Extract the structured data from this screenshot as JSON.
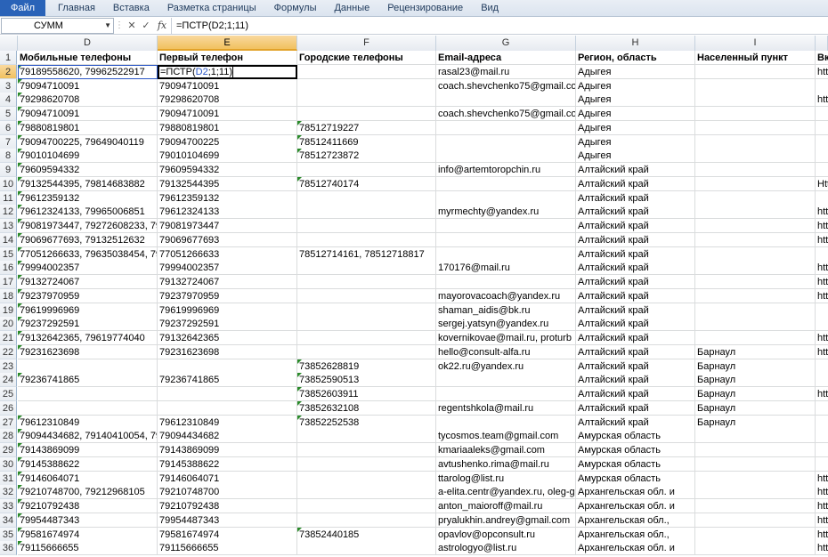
{
  "ribbon": {
    "tabs": [
      "Файл",
      "Главная",
      "Вставка",
      "Разметка страницы",
      "Формулы",
      "Данные",
      "Рецензирование",
      "Вид"
    ]
  },
  "formula_bar": {
    "name_box": "СУММ",
    "cancel_icon": "✕",
    "enter_icon": "✓",
    "fx_label": "fx",
    "formula": "=ПСТР(D2;1;11)"
  },
  "columns": [
    "D",
    "E",
    "F",
    "G",
    "H",
    "I"
  ],
  "active_cell": {
    "prefix": "=ПСТР(",
    "ref": "D2",
    "suffix": ";1;11)"
  },
  "rows": [
    {
      "n": "1",
      "d": "Мобильные телефоны",
      "e": "Первый телефон",
      "f": "Городские телефоны",
      "g": "Email-адреса",
      "h": "Регион, область",
      "i": "Населенный пункт",
      "j": "Вк"
    },
    {
      "n": "2",
      "d": "79189558620, 79962522917",
      "e": "",
      "f": "",
      "g": "rasal23@mail.ru",
      "h": "Адыгея",
      "i": "",
      "j": "htt"
    },
    {
      "n": "3",
      "d": "79094710091",
      "e": "79094710091",
      "f": "",
      "g": "coach.shevchenko75@gmail.com",
      "h": "Адыгея",
      "i": "",
      "j": ""
    },
    {
      "n": "4",
      "d": "79298620708",
      "e": "79298620708",
      "f": "",
      "g": "",
      "h": "Адыгея",
      "i": "",
      "j": "htt"
    },
    {
      "n": "5",
      "d": "79094710091",
      "e": "79094710091",
      "f": "",
      "g": "coach.shevchenko75@gmail.com",
      "h": "Адыгея",
      "i": "",
      "j": ""
    },
    {
      "n": "6",
      "d": "79880819801",
      "e": "79880819801",
      "f": "78512719227",
      "g": "",
      "h": "Адыгея",
      "i": "",
      "j": ""
    },
    {
      "n": "7",
      "d": "79094700225, 79649040119",
      "e": "79094700225",
      "f": "78512411669",
      "g": "",
      "h": "Адыгея",
      "i": "",
      "j": ""
    },
    {
      "n": "8",
      "d": "79010104699",
      "e": "79010104699",
      "f": "78512723872",
      "g": "",
      "h": "Адыгея",
      "i": "",
      "j": ""
    },
    {
      "n": "9",
      "d": "79609594332",
      "e": "79609594332",
      "f": "",
      "g": "info@artemtoropchin.ru",
      "h": "Алтайский край",
      "i": "",
      "j": ""
    },
    {
      "n": "10",
      "d": "79132544395, 79814683882",
      "e": "79132544395",
      "f": "78512740174",
      "g": "",
      "h": "Алтайский край",
      "i": "",
      "j": "Htt"
    },
    {
      "n": "11",
      "d": "79612359132",
      "e": "79612359132",
      "f": "",
      "g": "",
      "h": "Алтайский край",
      "i": "",
      "j": ""
    },
    {
      "n": "12",
      "d": "79612324133, 79965006851",
      "e": "79612324133",
      "f": "",
      "g": "myrmechty@yandex.ru",
      "h": "Алтайский край",
      "i": "",
      "j": "htt"
    },
    {
      "n": "13",
      "d": "79081973447, 79272608233, 7996",
      "e": "79081973447",
      "f": "",
      "g": "",
      "h": "Алтайский край",
      "i": "",
      "j": "htt"
    },
    {
      "n": "14",
      "d": "79069677693, 79132512632",
      "e": "79069677693",
      "f": "",
      "g": "",
      "h": "Алтайский край",
      "i": "",
      "j": "htt"
    },
    {
      "n": "15",
      "d": "77051266633, 79635038454, 7963",
      "e": "77051266633",
      "f": "78512714161, 78512718817",
      "g": "",
      "h": "Алтайский край",
      "i": "",
      "j": ""
    },
    {
      "n": "16",
      "d": "79994002357",
      "e": "79994002357",
      "f": "",
      "g": "170176@mail.ru",
      "h": "Алтайский край",
      "i": "",
      "j": "htt"
    },
    {
      "n": "17",
      "d": "79132724067",
      "e": "79132724067",
      "f": "",
      "g": "",
      "h": "Алтайский край",
      "i": "",
      "j": "htt"
    },
    {
      "n": "18",
      "d": "79237970959",
      "e": "79237970959",
      "f": "",
      "g": "mayorovacoach@yandex.ru",
      "h": "Алтайский край",
      "i": "",
      "j": "htt"
    },
    {
      "n": "19",
      "d": "79619996969",
      "e": "79619996969",
      "f": "",
      "g": "shaman_aidis@bk.ru",
      "h": "Алтайский край",
      "i": "",
      "j": ""
    },
    {
      "n": "20",
      "d": "79237292591",
      "e": "79237292591",
      "f": "",
      "g": "sergej.yatsyn@yandex.ru",
      "h": "Алтайский край",
      "i": "",
      "j": ""
    },
    {
      "n": "21",
      "d": "79132642365, 79619774040",
      "e": "79132642365",
      "f": "",
      "g": "kovernikovae@mail.ru, proturb",
      "h": "Алтайский край",
      "i": "",
      "j": "htt"
    },
    {
      "n": "22",
      "d": "79231623698",
      "e": "79231623698",
      "f": "",
      "g": "hello@consult-alfa.ru",
      "h": "Алтайский край",
      "i": "Барнаул",
      "j": "htt"
    },
    {
      "n": "23",
      "d": "",
      "e": "",
      "f": "73852628819",
      "g": "ok22.ru@yandex.ru",
      "h": "Алтайский край",
      "i": "Барнаул",
      "j": ""
    },
    {
      "n": "24",
      "d": "79236741865",
      "e": "79236741865",
      "f": "73852590513",
      "g": "",
      "h": "Алтайский край",
      "i": "Барнаул",
      "j": ""
    },
    {
      "n": "25",
      "d": "",
      "e": "",
      "f": "73852603911",
      "g": "",
      "h": "Алтайский край",
      "i": "Барнаул",
      "j": "htt"
    },
    {
      "n": "26",
      "d": "",
      "e": "",
      "f": "73852632108",
      "g": "regentshkola@mail.ru",
      "h": "Алтайский край",
      "i": "Барнаул",
      "j": ""
    },
    {
      "n": "27",
      "d": "79612310849",
      "e": "79612310849",
      "f": "73852252538",
      "g": "",
      "h": "Алтайский край",
      "i": "Барнаул",
      "j": ""
    },
    {
      "n": "28",
      "d": "79094434682, 79140410054, 7914",
      "e": "79094434682",
      "f": "",
      "g": "tycosmos.team@gmail.com",
      "h": "Амурская область",
      "i": "",
      "j": ""
    },
    {
      "n": "29",
      "d": "79143869099",
      "e": "79143869099",
      "f": "",
      "g": "kmariaaleks@gmail.com",
      "h": "Амурская область",
      "i": "",
      "j": ""
    },
    {
      "n": "30",
      "d": "79145388622",
      "e": "79145388622",
      "f": "",
      "g": "avtushenko.rima@mail.ru",
      "h": "Амурская область",
      "i": "",
      "j": ""
    },
    {
      "n": "31",
      "d": "79146064071",
      "e": "79146064071",
      "f": "",
      "g": "ttarolog@list.ru",
      "h": "Амурская область",
      "i": "",
      "j": "htt"
    },
    {
      "n": "32",
      "d": "79210748700, 79212968105",
      "e": "79210748700",
      "f": "",
      "g": "a-elita.centr@yandex.ru, oleg-g",
      "h": "Архангельская обл. и",
      "i": "",
      "j": "htt"
    },
    {
      "n": "33",
      "d": "79210792438",
      "e": "79210792438",
      "f": "",
      "g": "anton_maioroff@mail.ru",
      "h": "Архангельская обл. и",
      "i": "",
      "j": "htt"
    },
    {
      "n": "34",
      "d": "79954487343",
      "e": "79954487343",
      "f": "",
      "g": "pryalukhin.andrey@gmail.com",
      "h": "Архангельская обл.,",
      "i": "",
      "j": "htt"
    },
    {
      "n": "35",
      "d": "79581674974",
      "e": "79581674974",
      "f": "73852440185",
      "g": "opavlov@opconsult.ru",
      "h": "Архангельская обл.,",
      "i": "",
      "j": "htt"
    },
    {
      "n": "36",
      "d": "79115666655",
      "e": "79115666655",
      "f": "",
      "g": "astrologyo@list.ru",
      "h": "Архангельская обл. и",
      "i": "",
      "j": "htt"
    }
  ],
  "comment_flags_d": [
    "2",
    "3",
    "4",
    "5",
    "6",
    "7",
    "8",
    "9",
    "10",
    "11",
    "12",
    "13",
    "14",
    "15",
    "16",
    "17",
    "18",
    "19",
    "20",
    "21",
    "22",
    "24",
    "27",
    "28",
    "29",
    "30",
    "31",
    "32",
    "33",
    "34",
    "35",
    "36"
  ],
  "comment_flags_f": [
    "6",
    "7",
    "8",
    "10",
    "23",
    "24",
    "25",
    "26",
    "27",
    "35"
  ]
}
